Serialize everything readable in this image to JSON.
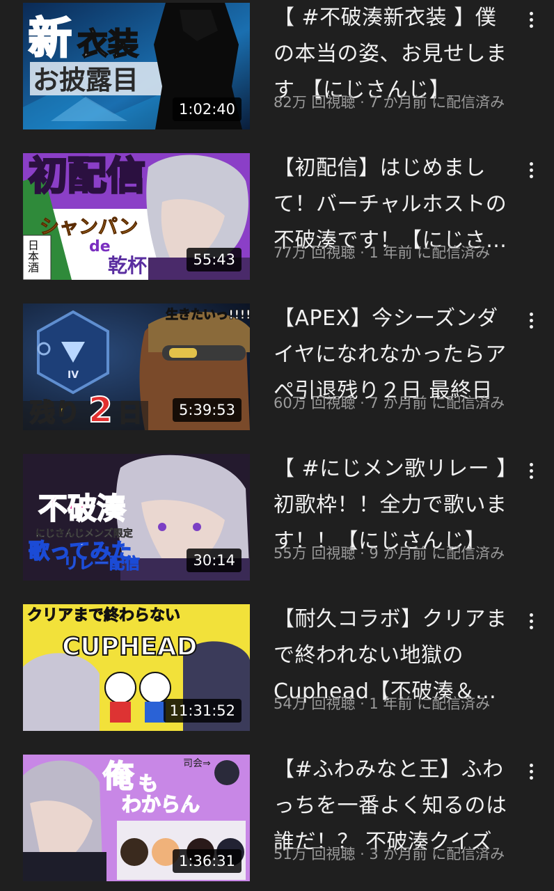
{
  "videos": [
    {
      "title": "【 #不破湊新衣装 】僕の本当の姿、お見せします 【にじさんじ】",
      "meta": "82万 回視聴 · 7 か月前 に配信済み",
      "duration": "1:02:40",
      "thumb_text": [
        "新",
        "衣装",
        "お披露目"
      ]
    },
    {
      "title": "【初配信】はじめまして！バーチャルホストの不破湊です！【にじさんじ】",
      "meta": "77万 回視聴 · 1 年前 に配信済み",
      "duration": "55:43",
      "thumb_text": [
        "初配信",
        "シャンパン",
        "de",
        "乾杯",
        "日本酒"
      ]
    },
    {
      "title": "【APEX】今シーズンダイヤになれなかったらアペ引退残り２日 最終日",
      "meta": "60万 回視聴 · 7 か月前 に配信済み",
      "duration": "5:39:53",
      "thumb_text": [
        "残り",
        "2",
        "日",
        "生きたいっ!!!!",
        "IV"
      ]
    },
    {
      "title": "【 #にじメン歌リレー 】初歌枠！！全力で歌います！！【にじさんじ】",
      "meta": "55万 回視聴 · 9 か月前 に配信済み",
      "duration": "30:14",
      "thumb_text": [
        "不破湊",
        "にじさんじメンズ限定",
        "歌ってみた",
        "リレー配信"
      ]
    },
    {
      "title": "【耐久コラボ】クリアまで終われない地獄のCuphead【不破湊＆長尾景】",
      "meta": "54万 回視聴 · 1 年前 に配信済み",
      "duration": "11:31:52",
      "thumb_text": [
        "クリアまで終わらない",
        "CUPHEAD"
      ]
    },
    {
      "title": "【#ふわみなと王】ふわっちを一番よく知るのは誰だ！？ 不破湊クイズ",
      "meta": "51万 回視聴 · 3 か月前 に配信済み",
      "duration": "1:36:31",
      "thumb_text": [
        "俺",
        "も",
        "わからん",
        "司会⇒"
      ]
    }
  ]
}
